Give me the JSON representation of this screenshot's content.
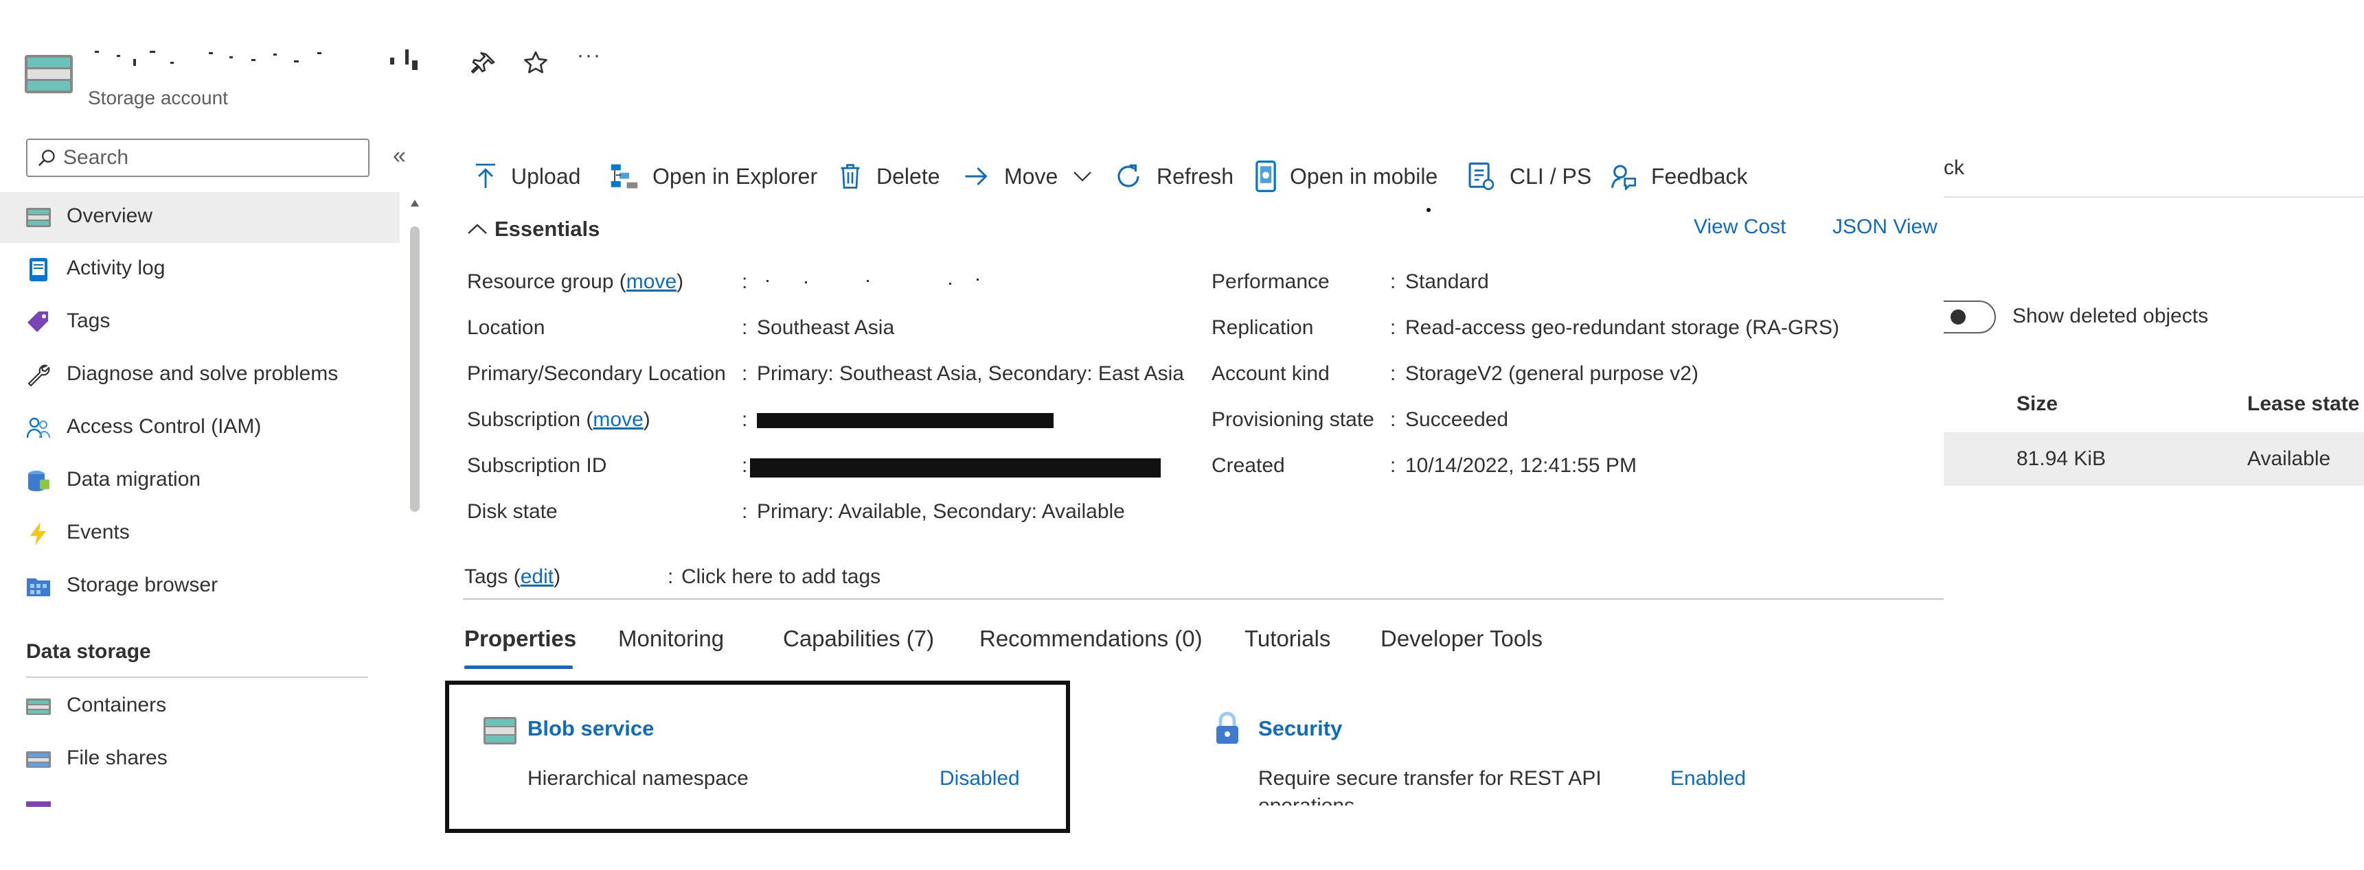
{
  "header": {
    "resource_type": "Storage account",
    "more_label": "···"
  },
  "sidebar": {
    "search_placeholder": "Search",
    "collapse_label": "«",
    "items": [
      {
        "label": "Overview"
      },
      {
        "label": "Activity log"
      },
      {
        "label": "Tags"
      },
      {
        "label": "Diagnose and solve problems"
      },
      {
        "label": "Access Control (IAM)"
      },
      {
        "label": "Data migration"
      },
      {
        "label": "Events"
      },
      {
        "label": "Storage browser"
      }
    ],
    "section": {
      "heading": "Data storage",
      "items": [
        {
          "label": "Containers"
        },
        {
          "label": "File shares"
        }
      ]
    }
  },
  "toolbar": {
    "upload": "Upload",
    "open_explorer": "Open in Explorer",
    "delete": "Delete",
    "move": "Move",
    "refresh": "Refresh",
    "open_mobile": "Open in mobile",
    "cli_ps": "CLI / PS",
    "feedback": "Feedback"
  },
  "essentials": {
    "title": "Essentials",
    "view_cost": "View Cost",
    "json_view": "JSON View",
    "move_link": "move",
    "edit_link": "edit",
    "left": {
      "resource_group_label": "Resource group (",
      "resource_group_suffix": ")",
      "location_label": "Location",
      "location_value": "Southeast Asia",
      "psl_label": "Primary/Secondary Location",
      "psl_value": "Primary: Southeast Asia, Secondary: East Asia",
      "subscription_label": "Subscription (",
      "subscription_suffix": ")",
      "subscription_id_label": "Subscription ID",
      "disk_state_label": "Disk state",
      "disk_state_value": "Primary: Available, Secondary: Available"
    },
    "right": {
      "performance_label": "Performance",
      "performance_value": "Standard",
      "replication_label": "Replication",
      "replication_value": "Read-access geo-redundant storage (RA-GRS)",
      "account_kind_label": "Account kind",
      "account_kind_value": "StorageV2 (general purpose v2)",
      "provisioning_label": "Provisioning state",
      "provisioning_value": "Succeeded",
      "created_label": "Created",
      "created_value": "10/14/2022, 12:41:55 PM"
    },
    "colon": ":",
    "tags_label": "Tags (",
    "tags_suffix": ")",
    "tags_value": "Click here to add tags"
  },
  "tabs": [
    {
      "label": "Properties"
    },
    {
      "label": "Monitoring"
    },
    {
      "label": "Capabilities (7)"
    },
    {
      "label": "Recommendations (0)"
    },
    {
      "label": "Tutorials"
    },
    {
      "label": "Developer Tools"
    }
  ],
  "properties": {
    "blob": {
      "title": "Blob service",
      "row_label": "Hierarchical namespace",
      "row_value": "Disabled"
    },
    "security": {
      "title": "Security",
      "row_label": "Require secure transfer for REST API",
      "row_label_cont": "operations",
      "row_value": "Enabled"
    }
  },
  "behind_panel": {
    "partial_link": "ck",
    "show_deleted": "Show deleted objects",
    "col_size": "Size",
    "col_lease": "Lease state",
    "row_size": "81.94 KiB",
    "row_lease": "Available"
  },
  "colors": {
    "accent": "#0f6cbd",
    "active_bg": "#ededed",
    "row_bg": "#ededed"
  }
}
